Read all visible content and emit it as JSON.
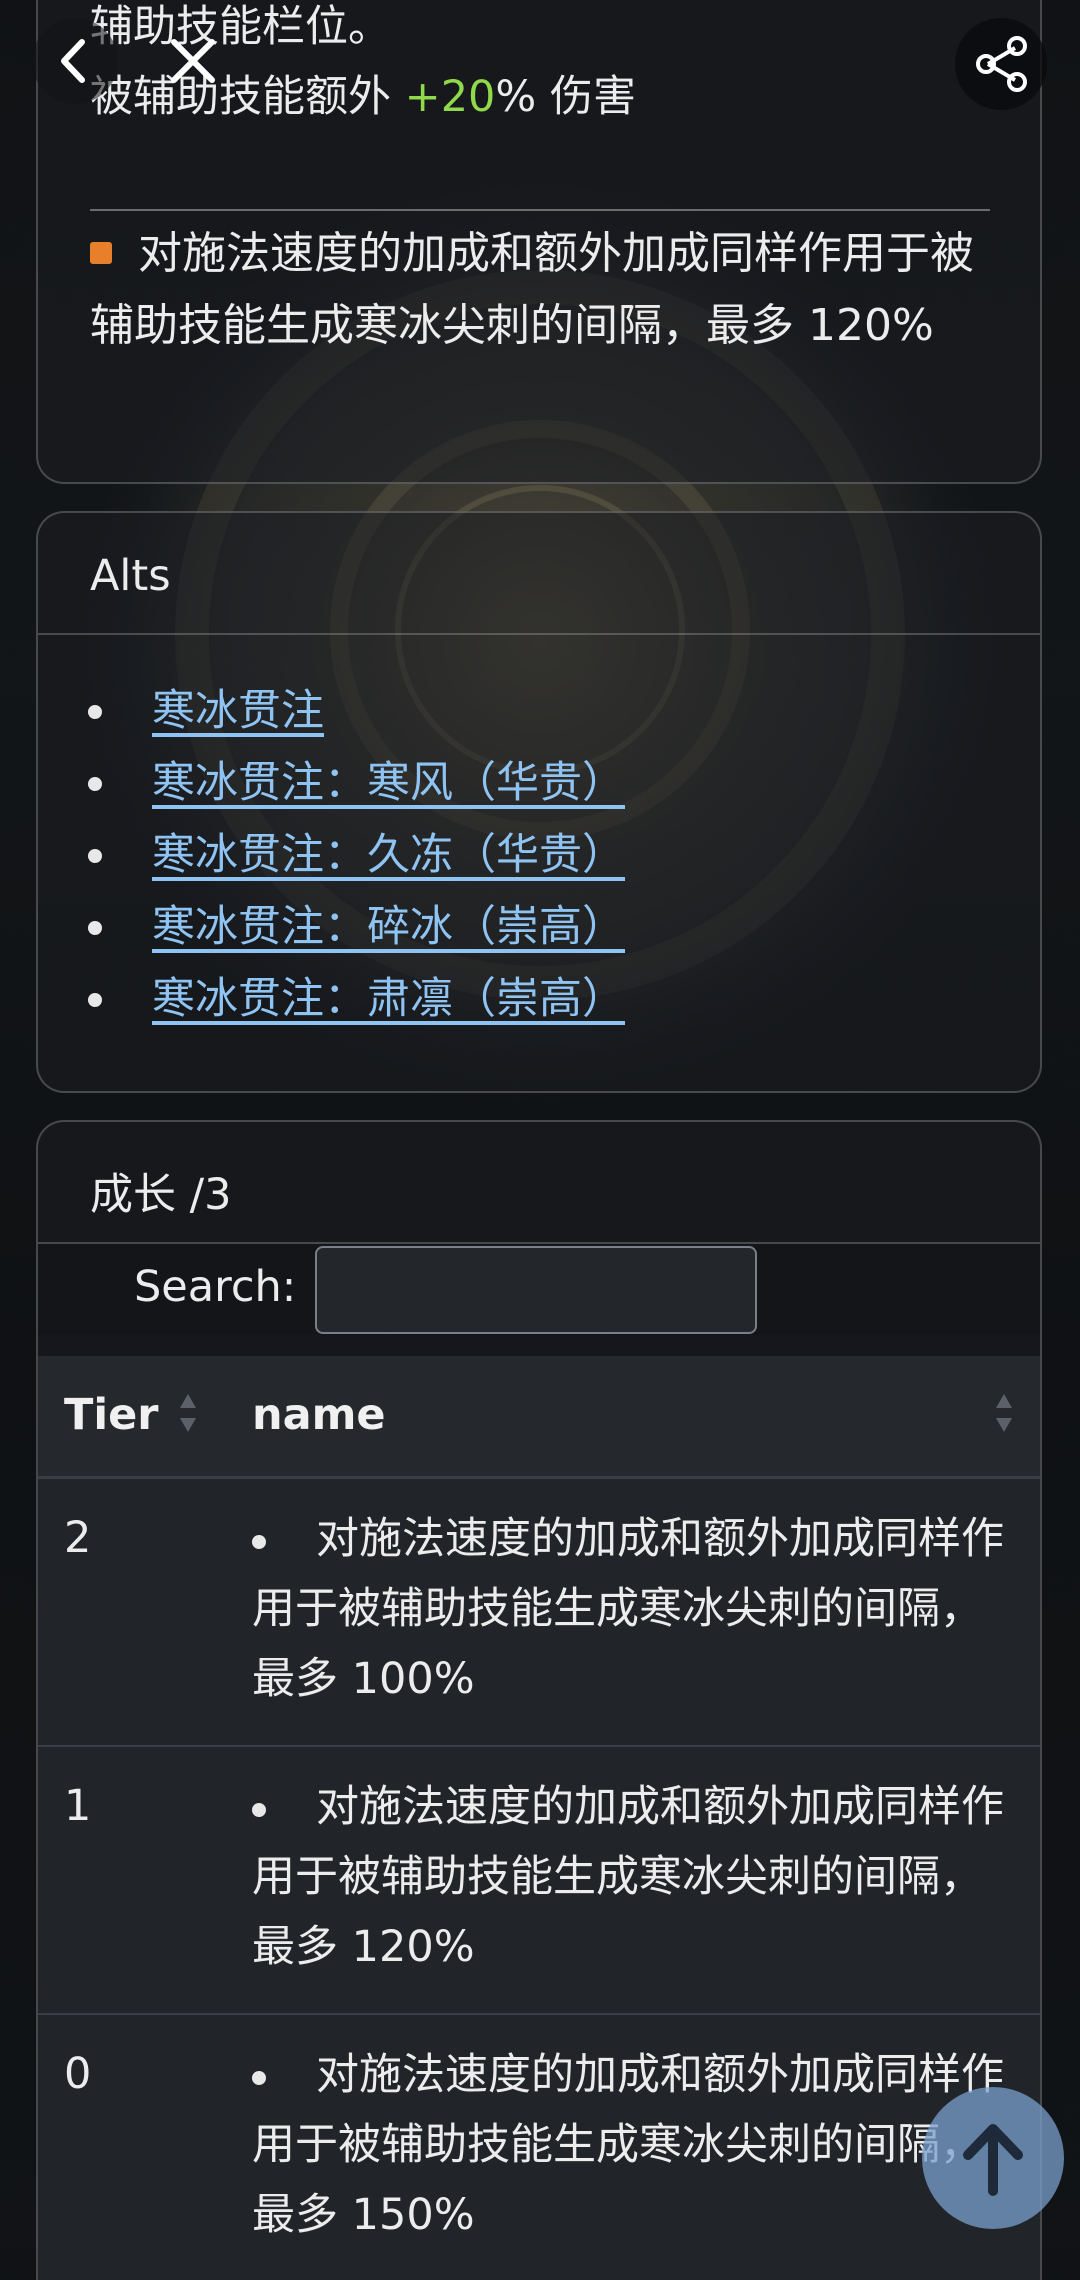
{
  "top_card": {
    "line1": "辅助技能栏位。",
    "line2_prefix": "被辅助技能额外 ",
    "line2_value": "+20",
    "line2_suffix": "% 伤害",
    "mod_text": "对施法速度的加成和额外加成同样作用于被辅助技能生成寒冰尖刺的间隔，最多 120%",
    "mod_color": "#e77f2b",
    "value_color": "#8fd94a"
  },
  "alts": {
    "title": "Alts",
    "items": [
      "寒冰贯注",
      "寒冰贯注：寒风（华贵）",
      "寒冰贯注：久冻（华贵）",
      "寒冰贯注：碎冰（崇高）",
      "寒冰贯注：肃凛（崇高）"
    ],
    "link_color": "#8fc3f2"
  },
  "growth": {
    "title": "成长 /3",
    "search_label": "Search:",
    "search_value": "",
    "columns": [
      "Tier",
      "name"
    ],
    "rows": [
      {
        "tier": "2",
        "name": "对施法速度的加成和额外加成同样作用于被辅助技能生成寒冰尖刺的间隔，最多 100%"
      },
      {
        "tier": "1",
        "name": "对施法速度的加成和额外加成同样作用于被辅助技能生成寒冰尖刺的间隔，最多 120%"
      },
      {
        "tier": "0",
        "name": "对施法速度的加成和额外加成同样作用于被辅助技能生成寒冰尖刺的间隔，最多 150%"
      }
    ]
  },
  "controls": {
    "back_icon": "chevron-left-icon",
    "close_icon": "close-icon",
    "share_icon": "share-icon",
    "scroll_top_icon": "arrow-up-icon"
  }
}
